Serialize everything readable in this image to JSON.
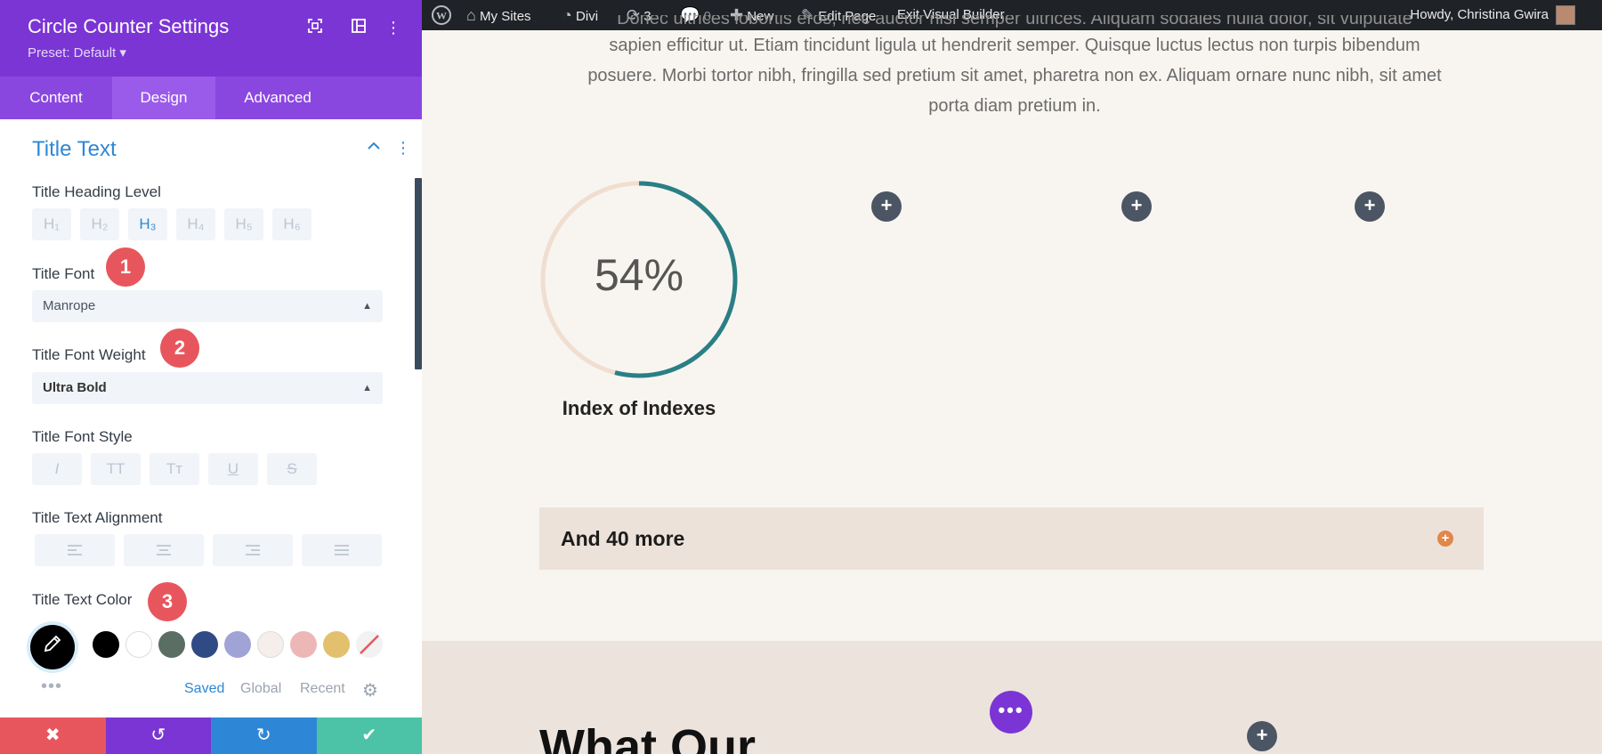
{
  "panel": {
    "title": "Circle Counter Settings",
    "preset": "Preset: Default ▾",
    "tabs": [
      "Content",
      "Design",
      "Advanced"
    ],
    "active_tab": "Design",
    "section_title": "Title Text",
    "heading_level": {
      "label": "Title Heading Level",
      "options": [
        "H₁",
        "H₂",
        "H₃",
        "H₄",
        "H₅",
        "H₆"
      ],
      "selected": "H₃"
    },
    "font": {
      "label": "Title Font",
      "value": "Manrope"
    },
    "weight": {
      "label": "Title Font Weight",
      "value": "Ultra Bold"
    },
    "style": {
      "label": "Title Font Style",
      "options": [
        "I",
        "TT",
        "Tт",
        "U",
        "S"
      ]
    },
    "alignment": {
      "label": "Title Text Alignment",
      "options": [
        "left",
        "center",
        "right",
        "justify"
      ]
    },
    "text_color": {
      "label": "Title Text Color",
      "swatches": [
        "#000000",
        "#ffffff",
        "#5a6e64",
        "#2f4a85",
        "#a0a3d6",
        "#f5eeeb",
        "#eeb7b7",
        "#e2c06e",
        "none"
      ],
      "tabs": [
        "Saved",
        "Global",
        "Recent"
      ],
      "active_tab": "Saved"
    },
    "badges": [
      "1",
      "2",
      "3"
    ],
    "bottom_actions": [
      "discard",
      "undo",
      "redo",
      "save"
    ]
  },
  "adminbar": {
    "my_sites": "My Sites",
    "divi": "Divi",
    "updates": "3",
    "comments": "0",
    "new": "New",
    "edit_page": "Edit Page",
    "exit": "Exit Visual Builder",
    "howdy": "Howdy, Christina Gwira"
  },
  "page": {
    "body_text_top": "Donec ultrices lobortis eros, nec auctor nisi semper ultrices. Aliquam sodales nulla dolor, sit vulputate",
    "body_text": "sapien efficitur ut. Etiam tincidunt ligula ut hendrerit semper. Quisque luctus lectus non turpis bibendum posuere. Morbi tortor nibh, fringilla sed pretium sit amet, pharetra non ex. Aliquam ornare nunc nibh, sit amet porta diam pretium in.",
    "counter": {
      "value": "54%",
      "percent": 54,
      "title": "Index of Indexes",
      "track_color": "#f0ded0",
      "fill_color": "#2a7f86"
    },
    "more_label": "And 40 more",
    "bottom_heading": "What Our"
  }
}
